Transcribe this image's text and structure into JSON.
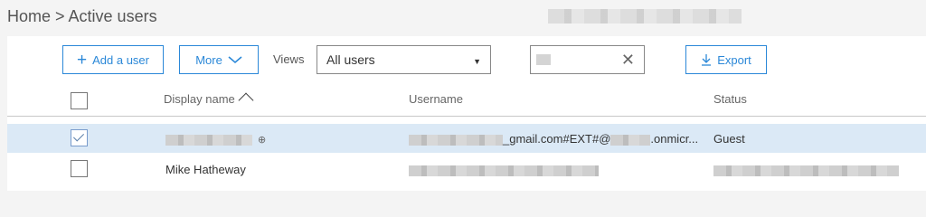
{
  "breadcrumb": "Home > Active users",
  "toolbar": {
    "add_user": "Add a user",
    "more": "More",
    "views_label": "Views",
    "views_value": "All users",
    "search_clear": "✕",
    "export": "Export"
  },
  "columns": {
    "display_name": "Display name",
    "username": "Username",
    "status": "Status"
  },
  "rows": [
    {
      "display_name": "",
      "username_visible": "_gmail.com#EXT#@",
      "username_suffix": ".onmicr...",
      "status": "Guest",
      "selected": true
    },
    {
      "display_name": "Mike Hatheway",
      "username_visible": "",
      "username_suffix": "",
      "status": "",
      "selected": false
    }
  ],
  "colors": {
    "accent": "#2b88d8",
    "selected_row": "#dbe9f6"
  }
}
